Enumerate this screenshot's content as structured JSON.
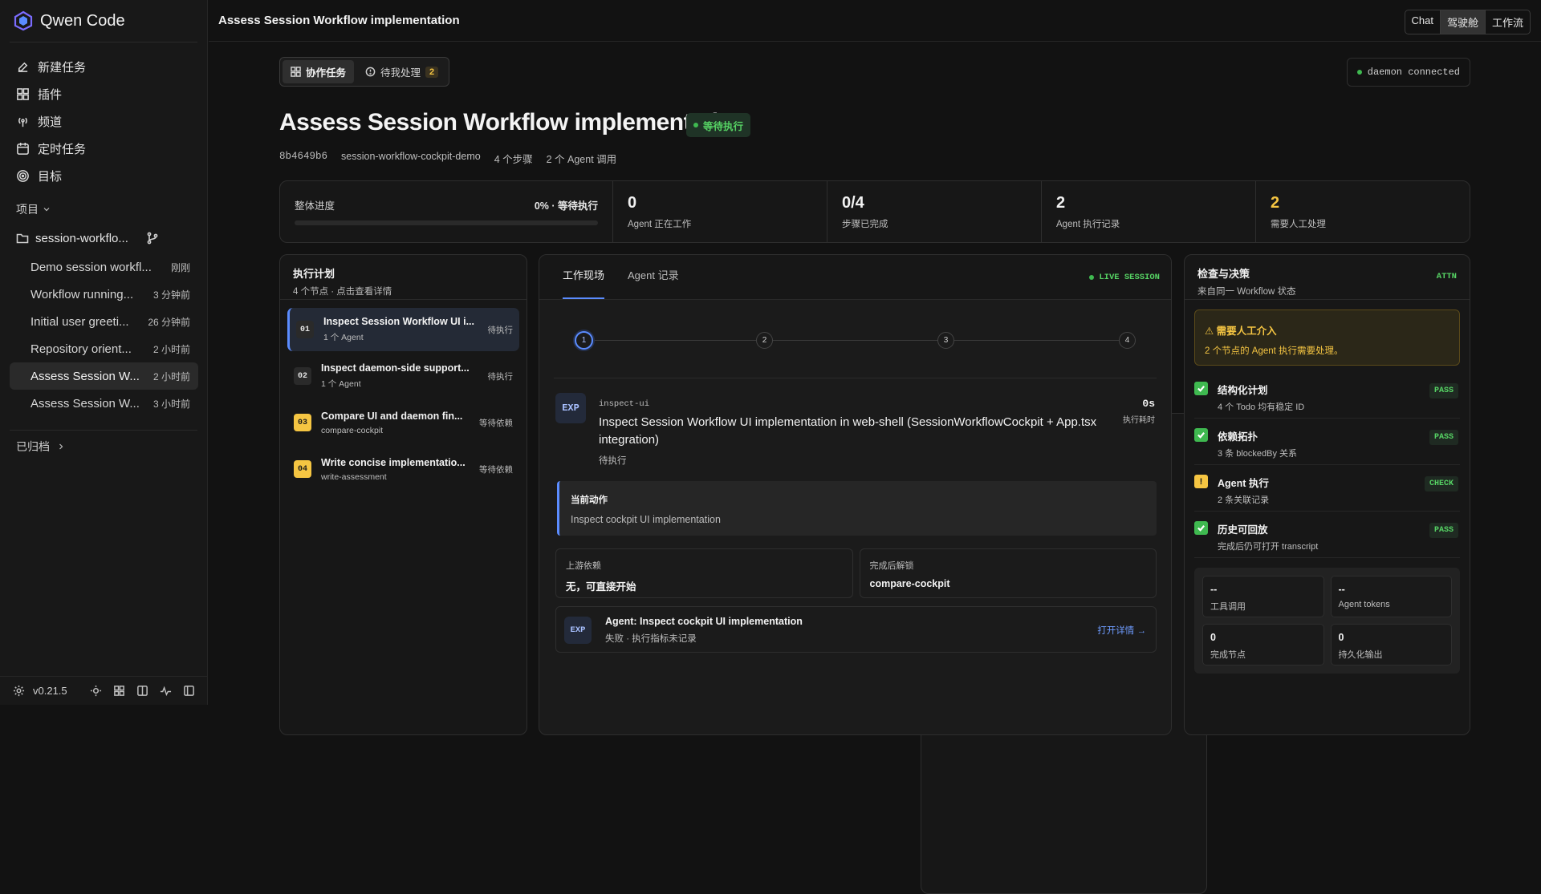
{
  "app": {
    "name": "Qwen Code",
    "version": "v0.21.5"
  },
  "nav": [
    {
      "label": "新建任务",
      "icon": "edit-icon"
    },
    {
      "label": "插件",
      "icon": "plugin-icon"
    },
    {
      "label": "频道",
      "icon": "broadcast-icon"
    },
    {
      "label": "定时任务",
      "icon": "calendar-icon"
    },
    {
      "label": "目标",
      "icon": "target-icon"
    }
  ],
  "projects": {
    "label": "项目",
    "folder": "session-workflo..."
  },
  "sessions": [
    {
      "title": "Demo session workfl...",
      "ago": "刚刚"
    },
    {
      "title": "Workflow running...",
      "ago": "3 分钟前"
    },
    {
      "title": "Initial user greeti...",
      "ago": "26 分钟前"
    },
    {
      "title": "Repository orient...",
      "ago": "2 小时前"
    },
    {
      "title": "Assess Session W...",
      "ago": "2 小时前"
    },
    {
      "title": "Assess Session W...",
      "ago": "3 小时前"
    }
  ],
  "archived_label": "已归档",
  "topbar": {
    "title": "Assess Session Workflow implementation",
    "views": [
      "Chat",
      "驾驶舱",
      "工作流"
    ],
    "active_view": "驾驶舱"
  },
  "main_tabs": {
    "collab": "协作任务",
    "pending": "待我处理",
    "pending_count": "2"
  },
  "daemon_status": "daemon connected",
  "workflow": {
    "title": "Assess Session Workflow implementation",
    "status": "等待执行",
    "id": "8b4649b6",
    "name": "session-workflow-cockpit-demo",
    "steps_count": "4 个步骤",
    "agent_calls": "2 个 Agent 调用"
  },
  "stats": {
    "progress_label": "整体进度",
    "progress_value": "0% · 等待执行",
    "progress_fraction": 0,
    "cards": [
      {
        "value": "0",
        "label": "Agent 正在工作",
        "warn": false
      },
      {
        "value": "0/4",
        "label": "步骤已完成",
        "warn": false
      },
      {
        "value": "2",
        "label": "Agent 执行记录",
        "warn": false
      },
      {
        "value": "2",
        "label": "需要人工处理",
        "warn": true
      }
    ]
  },
  "plan": {
    "title": "执行计划",
    "subtitle": "4 个节点 · 点击查看详情",
    "steps": [
      {
        "num": "01",
        "title": "Inspect Session Workflow UI i...",
        "sub": "1 个 Agent",
        "state": "待执行"
      },
      {
        "num": "02",
        "title": "Inspect daemon-side support...",
        "sub": "1 个 Agent",
        "state": "待执行"
      },
      {
        "num": "03",
        "title": "Compare UI and daemon fin...",
        "sub": "compare-cockpit",
        "state": "等待依赖"
      },
      {
        "num": "04",
        "title": "Write concise implementatio...",
        "sub": "write-assessment",
        "state": "等待依赖"
      }
    ]
  },
  "center": {
    "tabs": [
      "工作现场",
      "Agent 记录"
    ],
    "live": "LIVE SESSION",
    "timeline": [
      "1",
      "2",
      "3",
      "4"
    ],
    "task": {
      "badge": "EXP",
      "kind": "inspect-ui",
      "title": "Inspect Session Workflow UI implementation in web-shell (SessionWorkflowCockpit + App.tsx integration)",
      "state": "待执行",
      "duration": "0s",
      "duration_label": "执行耗时"
    },
    "action": {
      "title": "当前动作",
      "value": "Inspect cockpit UI implementation"
    },
    "deps": {
      "upstream_label": "上游依赖",
      "upstream_value": "无，可直接开始",
      "unlock_label": "完成后解锁",
      "unlock_value": "compare-cockpit"
    },
    "agent": {
      "badge": "EXP",
      "name": "Agent: Inspect cockpit UI implementation",
      "status": "失败 · 执行指标未记录",
      "link": "打开详情 →"
    }
  },
  "review": {
    "title": "检查与决策",
    "subtitle": "来自同一 Workflow 状态",
    "attn": "ATTN",
    "alert_title": "⚠ 需要人工介入",
    "alert_text": "2 个节点的 Agent 执行需要处理。",
    "checks": [
      {
        "title": "结构化计划",
        "sub": "4 个 Todo 均有稳定 ID",
        "tag": "PASS",
        "warn": false
      },
      {
        "title": "依赖拓扑",
        "sub": "3 条 blockedBy 关系",
        "tag": "PASS",
        "warn": false
      },
      {
        "title": "Agent 执行",
        "sub": "2 条关联记录",
        "tag": "CHECK",
        "warn": true
      },
      {
        "title": "历史可回放",
        "sub": "完成后仍可打开 transcript",
        "tag": "PASS",
        "warn": false
      }
    ],
    "metrics": [
      {
        "value": "--",
        "label": "工具调用"
      },
      {
        "value": "--",
        "label": "Agent tokens"
      },
      {
        "value": "0",
        "label": "完成节点"
      },
      {
        "value": "0",
        "label": "持久化输出"
      }
    ]
  },
  "colors": {
    "accent": "#5b8cff",
    "success": "#3fb950",
    "warning": "#f5c542"
  }
}
